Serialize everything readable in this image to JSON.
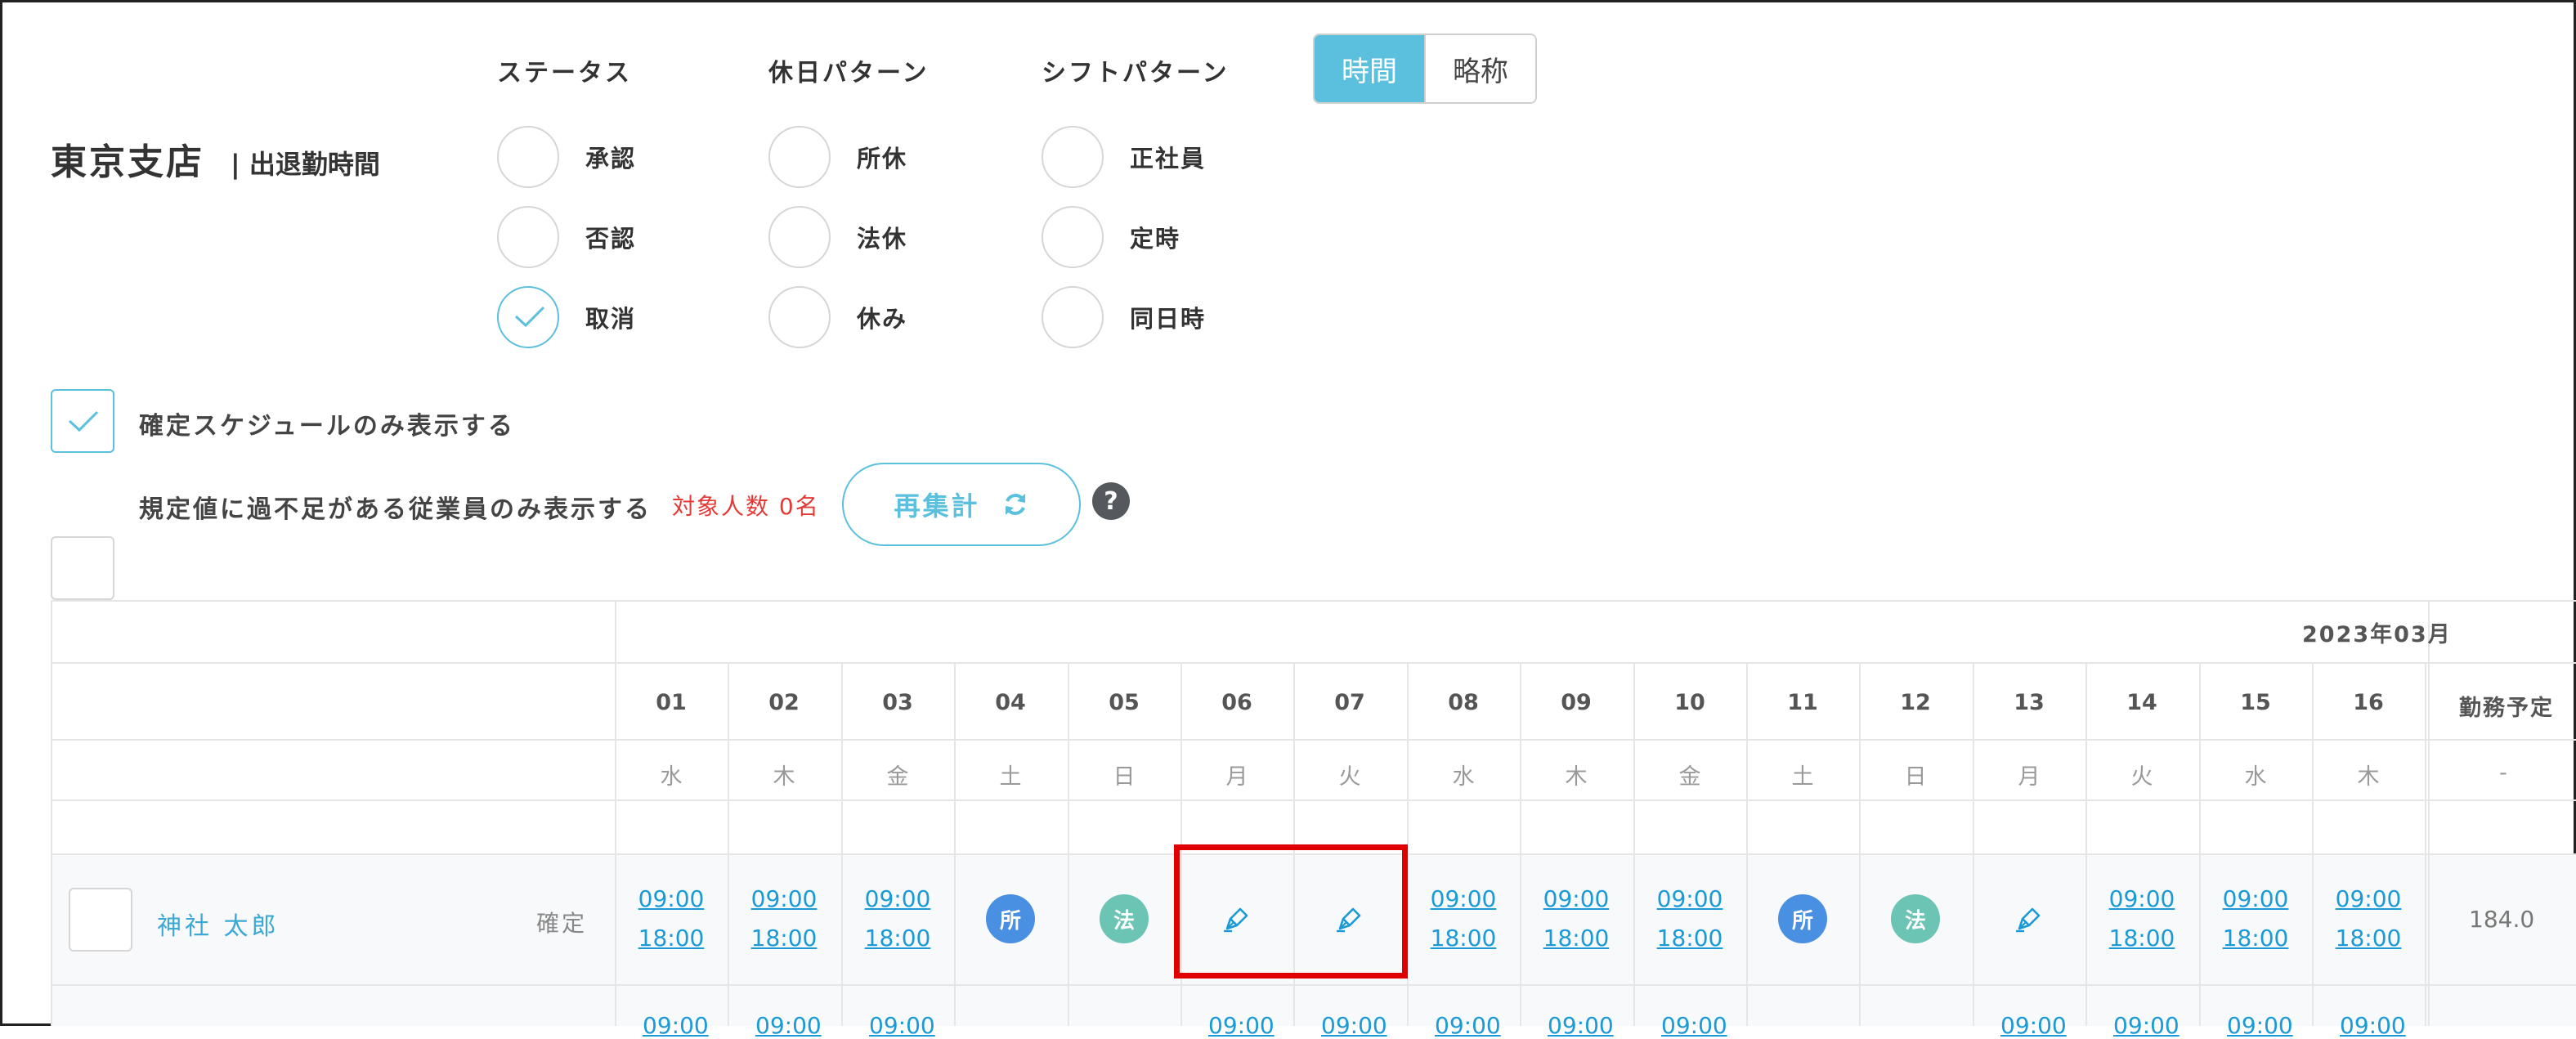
{
  "header": {
    "branch": "東京支店",
    "subtitle": "| 出退勤時間"
  },
  "filters": {
    "status": {
      "title": "ステータス",
      "options": [
        "承認",
        "否認",
        "取消"
      ],
      "checked_index": 2
    },
    "holiday": {
      "title": "休日パターン",
      "options": [
        "所休",
        "法休",
        "休み"
      ]
    },
    "shift": {
      "title": "シフトパターン",
      "options": [
        "正社員",
        "定時",
        "同日時"
      ]
    }
  },
  "toggle": {
    "active": "時間",
    "inactive": "略称"
  },
  "checkboxes": {
    "confirmed_only": {
      "label": "確定スケジュールのみ表示する",
      "checked": true
    },
    "deficit_only": {
      "label": "規定値に過不足がある従業員のみ表示する",
      "checked": false
    }
  },
  "count_text": "対象人数 0名",
  "recalc_label": "再集計",
  "help_label": "?",
  "table": {
    "month": "2023年03月",
    "days": [
      {
        "num": "01",
        "dow": "水"
      },
      {
        "num": "02",
        "dow": "木"
      },
      {
        "num": "03",
        "dow": "金"
      },
      {
        "num": "04",
        "dow": "土"
      },
      {
        "num": "05",
        "dow": "日"
      },
      {
        "num": "06",
        "dow": "月"
      },
      {
        "num": "07",
        "dow": "火"
      },
      {
        "num": "08",
        "dow": "水"
      },
      {
        "num": "09",
        "dow": "木"
      },
      {
        "num": "10",
        "dow": "金"
      },
      {
        "num": "11",
        "dow": "土"
      },
      {
        "num": "12",
        "dow": "日"
      },
      {
        "num": "13",
        "dow": "月"
      },
      {
        "num": "14",
        "dow": "火"
      },
      {
        "num": "15",
        "dow": "水"
      },
      {
        "num": "16",
        "dow": "木"
      }
    ],
    "summary_col": {
      "title": "勤務予定",
      "sub": "-"
    },
    "employee": {
      "name": "神社 太郎",
      "status": "確定",
      "total": "184.0",
      "start": "09:00",
      "end": "18:00",
      "badge_labels": {
        "shokyu": "所",
        "hokyu": "法"
      },
      "cells": [
        "time",
        "time",
        "time",
        "shokyu",
        "hokyu",
        "edit",
        "edit",
        "time",
        "time",
        "time",
        "shokyu",
        "hokyu",
        "edit",
        "time",
        "time",
        "time"
      ]
    },
    "colors": {
      "accent": "#5bc0de",
      "link": "#1a9ad6",
      "shokyu": "#4a90e2",
      "hokyu": "#6cc4b4",
      "highlight": "#e00000"
    }
  }
}
